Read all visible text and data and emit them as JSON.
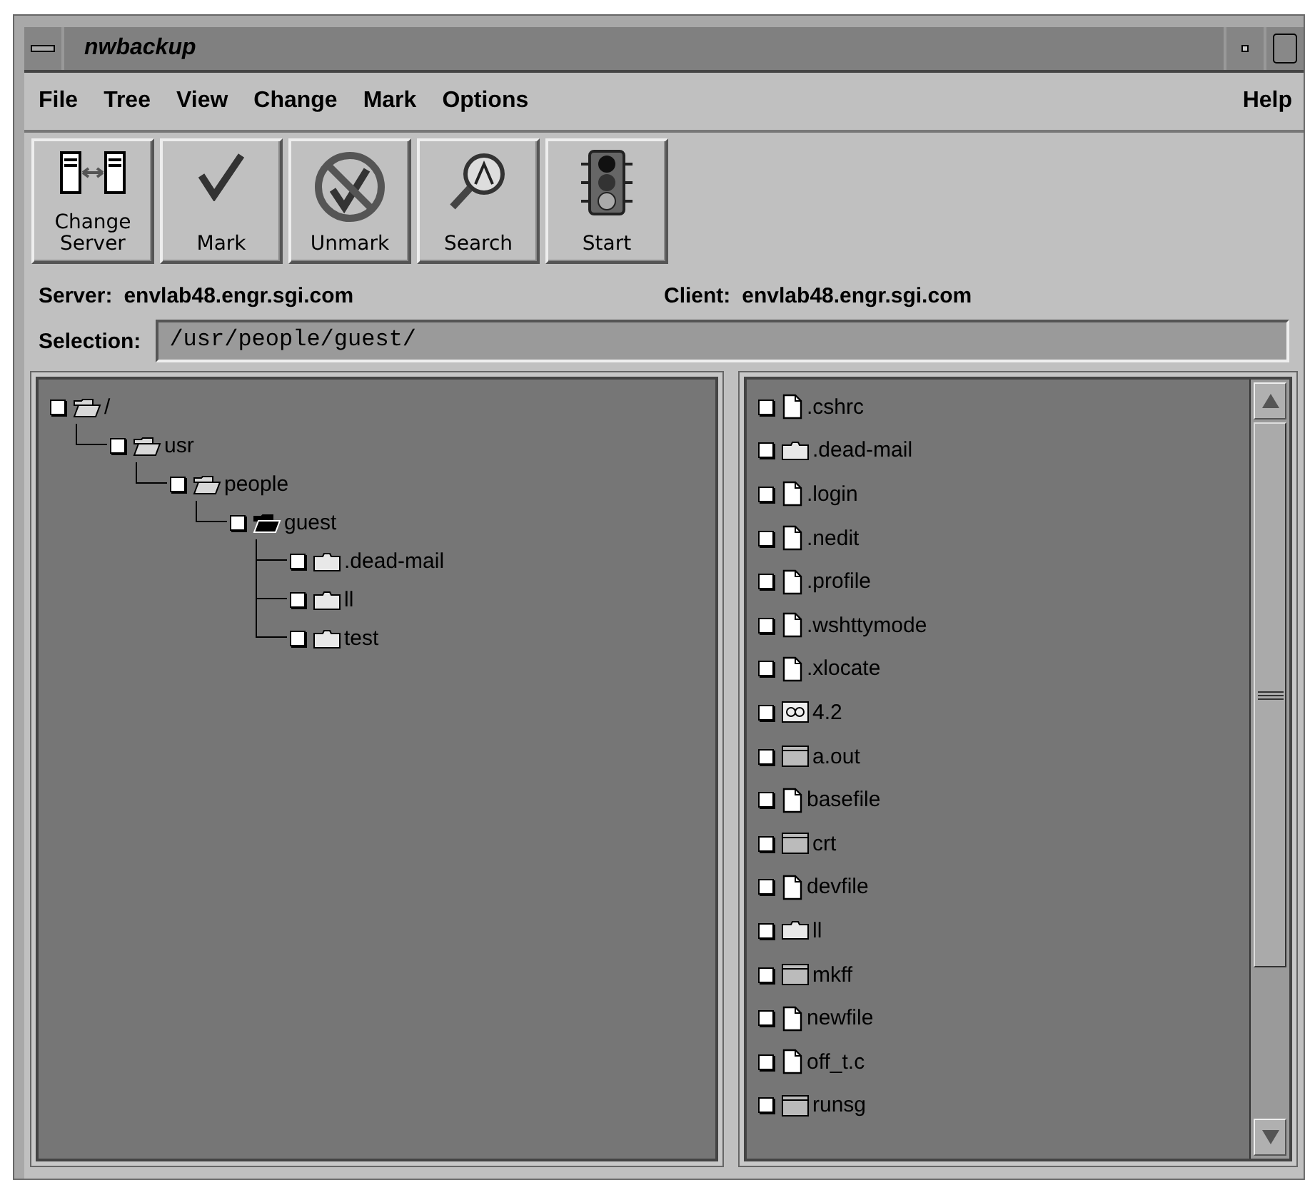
{
  "window": {
    "title": "nwbackup"
  },
  "menu": [
    "File",
    "Tree",
    "View",
    "Change",
    "Mark",
    "Options"
  ],
  "help_menu": "Help",
  "toolbar": [
    {
      "label": "Change Server",
      "kind": "servers"
    },
    {
      "label": "Mark",
      "kind": "mark"
    },
    {
      "label": "Unmark",
      "kind": "unmark"
    },
    {
      "label": "Search",
      "kind": "search"
    },
    {
      "label": "Start",
      "kind": "start"
    }
  ],
  "server": {
    "label": "Server:",
    "value": "envlab48.engr.sgi.com"
  },
  "client": {
    "label": "Client:",
    "value": "envlab48.engr.sgi.com"
  },
  "selection": {
    "label": "Selection:",
    "value": "/usr/people/guest/"
  },
  "tree": {
    "name": "/",
    "checked": false,
    "expanded": true,
    "selected": false,
    "children": [
      {
        "name": "usr",
        "checked": false,
        "expanded": true,
        "selected": false,
        "children": [
          {
            "name": "people",
            "checked": false,
            "expanded": true,
            "selected": false,
            "children": [
              {
                "name": "guest",
                "checked": false,
                "expanded": true,
                "selected": true,
                "children": [
                  {
                    "name": ".dead-mail",
                    "checked": false,
                    "expanded": false,
                    "selected": false
                  },
                  {
                    "name": "ll",
                    "checked": false,
                    "expanded": false,
                    "selected": false
                  },
                  {
                    "name": "test",
                    "checked": false,
                    "expanded": false,
                    "selected": false
                  }
                ]
              }
            ]
          }
        ]
      }
    ]
  },
  "files": [
    {
      "name": ".cshrc",
      "kind": "file",
      "checked": false
    },
    {
      "name": ".dead-mail",
      "kind": "folder",
      "checked": false
    },
    {
      "name": ".login",
      "kind": "file",
      "checked": false
    },
    {
      "name": ".nedit",
      "kind": "file",
      "checked": false
    },
    {
      "name": ".profile",
      "kind": "file",
      "checked": false
    },
    {
      "name": ".wshttymode",
      "kind": "file",
      "checked": false
    },
    {
      "name": ".xlocate",
      "kind": "file",
      "checked": false
    },
    {
      "name": "4.2",
      "kind": "link",
      "checked": false
    },
    {
      "name": "a.out",
      "kind": "program",
      "checked": false
    },
    {
      "name": "basefile",
      "kind": "file",
      "checked": false
    },
    {
      "name": "crt",
      "kind": "program",
      "checked": false
    },
    {
      "name": "devfile",
      "kind": "file",
      "checked": false
    },
    {
      "name": "ll",
      "kind": "folder",
      "checked": false
    },
    {
      "name": "mkff",
      "kind": "program",
      "checked": false
    },
    {
      "name": "newfile",
      "kind": "file",
      "checked": false
    },
    {
      "name": "off_t.c",
      "kind": "file",
      "checked": false
    },
    {
      "name": "runsg",
      "kind": "program",
      "checked": false
    }
  ]
}
